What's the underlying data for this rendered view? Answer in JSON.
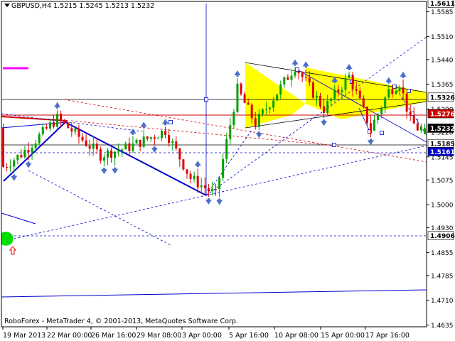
{
  "window": {
    "symbol_info": "GBPUSD,H4  1.5215 1.5245 1.5213 1.5232",
    "copyright": "RoboForex - MetaTrader 4, © 2001-2013, MetaQuotes Software Corp."
  },
  "colors": {
    "background": "#ffffff",
    "bull_candle": "#00a000",
    "bear_candle": "#e00000",
    "trend_line": "#0000cc",
    "resistance_line": "#cc0000",
    "triangle_fill": "#ffff00",
    "magenta_marker": "#ff00ff",
    "target_green": "#00dd00"
  },
  "chart_data": {
    "type": "candlestick",
    "title": "",
    "symbol": "GBPUSD",
    "timeframe": "H4",
    "ohlc_header": {
      "open": 1.5215,
      "high": 1.5245,
      "low": 1.5213,
      "close": 1.5232
    },
    "ylim": [
      1.4635,
      1.5611
    ],
    "y_ticks": [
      1.5585,
      1.551,
      1.544,
      1.5365,
      1.529,
      1.522,
      1.5145,
      1.5075,
      1.5,
      1.493,
      1.4855,
      1.4785,
      1.471,
      1.4635
    ],
    "y_tick_labels": [
      "1.5585",
      "1.5510",
      "1.5440",
      "1.5365",
      "1.5290",
      "1.5220",
      "1.5145",
      "1.5075",
      "1.5000",
      "1.4930",
      "1.4855",
      "1.4785",
      "1.4710",
      "1.4635"
    ],
    "x_tick_labels": [
      "19 Mar 2013",
      "22 Mar 00:00",
      "26 Mar 16:00",
      "29 Mar 08:00",
      "3 Apr 00:00",
      "5 Apr 16:00",
      "10 Apr 08:00",
      "15 Apr 00:00",
      "17 Apr 16:00"
    ],
    "price_labels": [
      {
        "value": 1.5611,
        "text": "1.5611",
        "style": "white"
      },
      {
        "value": 1.5326,
        "text": "1.5326",
        "style": "white"
      },
      {
        "value": 1.5276,
        "text": "1.5276",
        "style": "red"
      },
      {
        "value": 1.5232,
        "text": "1.5232",
        "style": "black"
      },
      {
        "value": 1.5185,
        "text": "1.5185",
        "style": "white"
      },
      {
        "value": 1.5161,
        "text": "1.5161",
        "style": "blue"
      },
      {
        "value": 1.4906,
        "text": "1.4906",
        "style": "white"
      }
    ],
    "key_path": [
      {
        "t": 1,
        "p": 1.5115
      },
      {
        "t": 6,
        "p": 1.5153
      },
      {
        "t": 16,
        "p": 1.5262
      },
      {
        "t": 28,
        "p": 1.515
      },
      {
        "t": 36,
        "p": 1.5175
      },
      {
        "t": 46,
        "p": 1.5225
      },
      {
        "t": 53,
        "p": 1.508
      },
      {
        "t": 60,
        "p": 1.503
      },
      {
        "t": 66,
        "p": 1.535
      },
      {
        "t": 71,
        "p": 1.5245
      },
      {
        "t": 82,
        "p": 1.542
      },
      {
        "t": 90,
        "p": 1.529
      },
      {
        "t": 97,
        "p": 1.539
      },
      {
        "t": 103,
        "p": 1.523
      },
      {
        "t": 108,
        "p": 1.5345
      },
      {
        "t": 111,
        "p": 1.537
      },
      {
        "t": 114,
        "p": 1.5255
      },
      {
        "t": 116,
        "p": 1.5232
      }
    ]
  }
}
